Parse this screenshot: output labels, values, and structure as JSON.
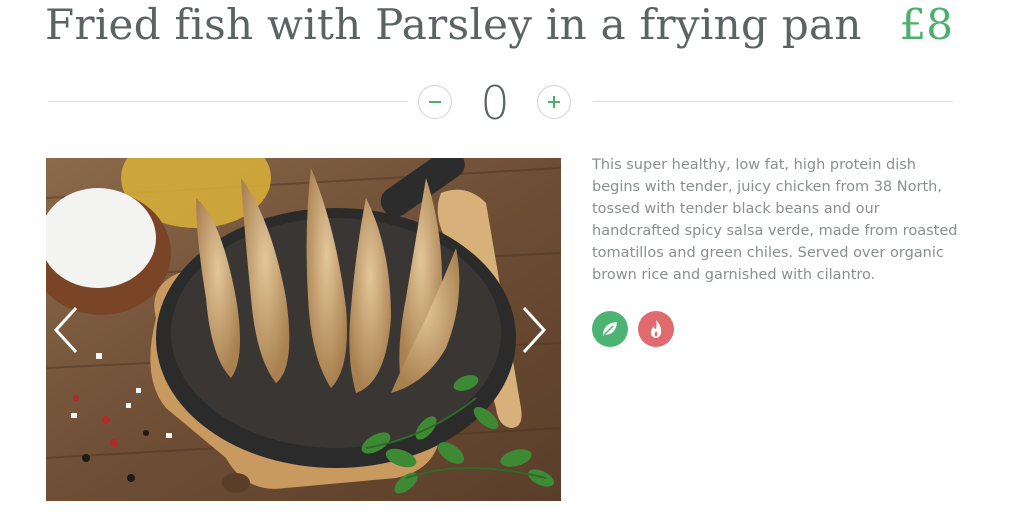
{
  "dish": {
    "title": "Fried fish with Parsley in a frying pan",
    "price": "£8",
    "quantity": "0",
    "description": "This super healthy, low fat, high protein dish begins with tender, juicy chicken from 38 North, tossed with tender black beans and our handcrafted spicy salsa verde, made from roasted tomatillos and green chiles. Served over organic brown rice and garnished with cilantro.",
    "badges": [
      {
        "icon": "leaf-icon",
        "color": "#4cb373"
      },
      {
        "icon": "flame-icon",
        "color": "#e06a6d"
      }
    ]
  },
  "quantity_controls": {
    "decrement_icon": "minus-icon",
    "increment_icon": "plus-icon"
  },
  "gallery": {
    "prev_icon": "chevron-left-icon",
    "next_icon": "chevron-right-icon"
  },
  "colors": {
    "accent": "#4caf6c",
    "text": "#5b6462",
    "muted": "#8a8f8e"
  }
}
